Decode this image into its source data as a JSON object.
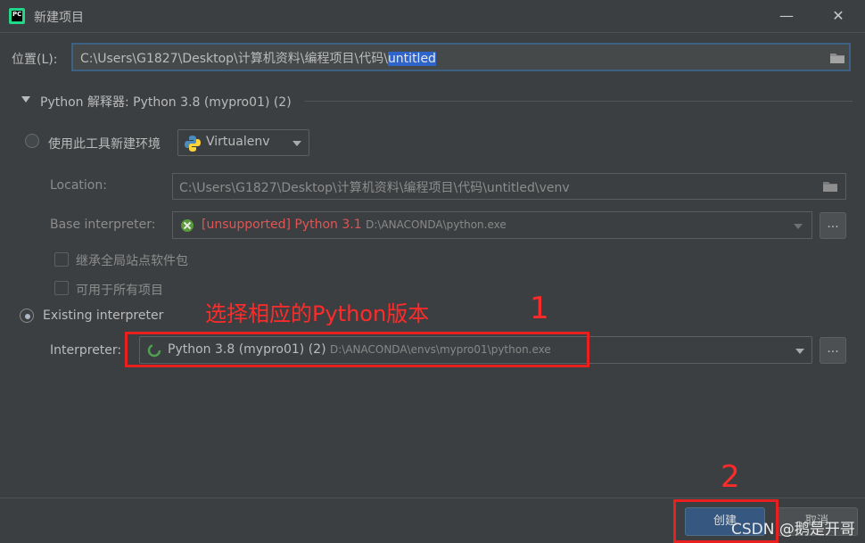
{
  "window": {
    "app_icon_text": "PC",
    "title": "新建项目",
    "minimize_glyph": "—",
    "close_glyph": "✕"
  },
  "location": {
    "label": "位置(L):",
    "path_prefix": "C:\\Users\\G1827\\Desktop\\计算机资料\\编程项目\\代码\\",
    "path_selected": "untitled"
  },
  "interpreter_section": {
    "title": "Python 解释器: Python 3.8 (mypro01) (2)"
  },
  "new_env": {
    "radio_label": "使用此工具新建环境",
    "tool_value": "Virtualenv",
    "location_label": "Location:",
    "location_value": "C:\\Users\\G1827\\Desktop\\计算机资料\\编程项目\\代码\\untitled\\venv",
    "base_label": "Base interpreter:",
    "base_value_error": "[unsupported] Python 3.1",
    "base_value_path": "D:\\ANACONDA\\python.exe",
    "inherit_label": "继承全局站点软件包",
    "available_label": "可用于所有项目"
  },
  "existing": {
    "radio_label": "Existing interpreter",
    "interpreter_label": "Interpreter:",
    "interpreter_value": "Python 3.8 (mypro01) (2)",
    "interpreter_path": "D:\\ANACONDA\\envs\\mypro01\\python.exe",
    "browse_label": "..."
  },
  "annotations": {
    "hint_text": "选择相应的Python版本",
    "step_1": "1",
    "step_2": "2"
  },
  "buttons": {
    "create": "创建",
    "cancel": "取消"
  },
  "watermark": "CSDN @鹅是开哥",
  "colors": {
    "background": "#3c3f41",
    "selection": "#2f65ca",
    "error": "#e05555",
    "annotation_red": "#e8201f",
    "primary_button": "#365880"
  }
}
